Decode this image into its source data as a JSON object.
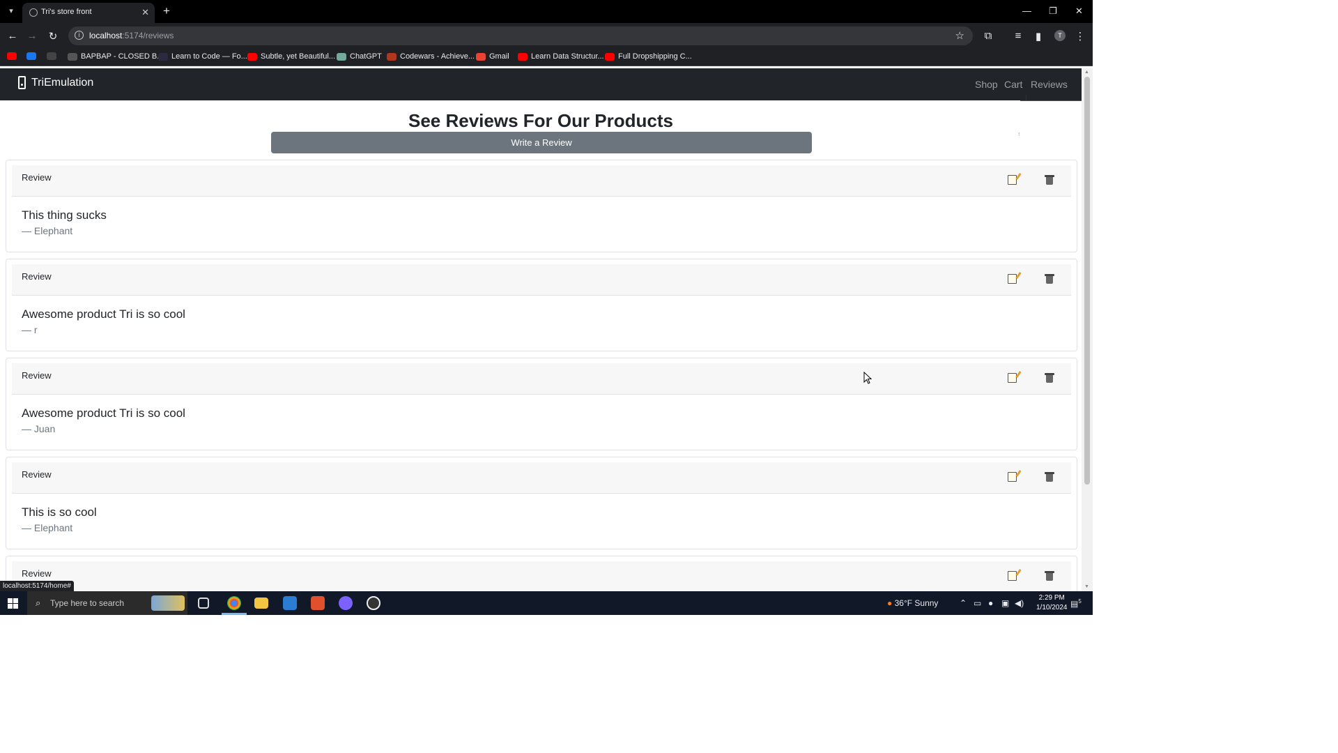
{
  "browser": {
    "tab_title": "Tri's store front",
    "new_tab_label": "+",
    "url_host": "localhost",
    "url_path": ":5174/reviews",
    "profile_initial": "T",
    "bookmarks": [
      {
        "label": "",
        "color": "#ff0000"
      },
      {
        "label": "",
        "color": "#1877f2"
      },
      {
        "label": "",
        "color": "#444444"
      },
      {
        "label": "BAPBAP - CLOSED B...",
        "color": "#555555"
      },
      {
        "label": "Learn to Code — Fo...",
        "color": "#2a2a40"
      },
      {
        "label": "Subtle, yet Beautiful...",
        "color": "#ff0000"
      },
      {
        "label": "ChatGPT",
        "color": "#74aa9c"
      },
      {
        "label": "Codewars - Achieve...",
        "color": "#b1361e"
      },
      {
        "label": "Gmail",
        "color": "#ea4335"
      },
      {
        "label": "Learn Data Structur...",
        "color": "#ff0000"
      },
      {
        "label": "Full Dropshipping C...",
        "color": "#ff0000"
      }
    ],
    "status_url": "localhost:5174/home#"
  },
  "site": {
    "brand": "TriEmulation",
    "nav": {
      "shop": "Shop",
      "cart": "Cart",
      "reviews": "Reviews"
    },
    "heading": "See Reviews For Our Products",
    "write_button": "Write a Review",
    "reviews": [
      {
        "header": "Review",
        "text": "This thing sucks",
        "author": "— Elephant"
      },
      {
        "header": "Review",
        "text": "Awesome product Tri is so cool",
        "author": "— r"
      },
      {
        "header": "Review",
        "text": "Awesome product Tri is so cool",
        "author": "— Juan"
      },
      {
        "header": "Review",
        "text": "This is so cool",
        "author": "— Elephant"
      },
      {
        "header": "Review",
        "text": "",
        "author": ""
      }
    ]
  },
  "taskbar": {
    "search_placeholder": "Type here to search",
    "weather": "36°F  Sunny",
    "time": "2:29 PM",
    "date": "1/10/2024",
    "notification_count": "5"
  }
}
